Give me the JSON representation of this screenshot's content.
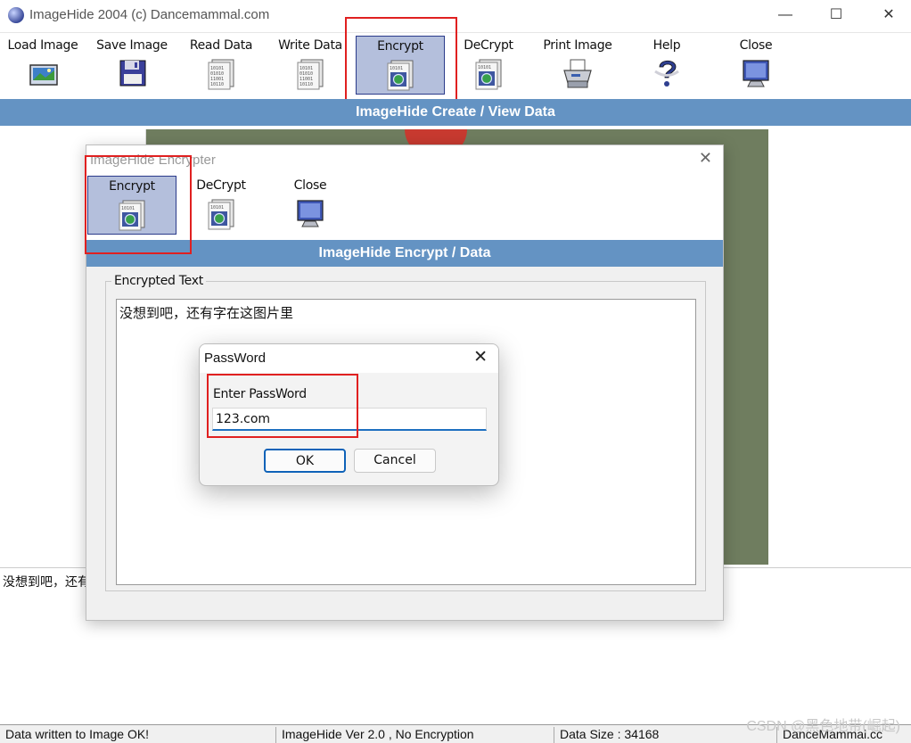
{
  "window": {
    "title": "ImageHide 2004 (c) Dancemammal.com",
    "minimize": "—",
    "maximize": "☐",
    "close": "✕"
  },
  "toolbar": {
    "items": [
      {
        "label": "Load Image",
        "icon": "load-image-icon"
      },
      {
        "label": "Save Image",
        "icon": "save-image-icon"
      },
      {
        "label": "Read Data",
        "icon": "read-data-icon"
      },
      {
        "label": "Write Data",
        "icon": "write-data-icon"
      },
      {
        "label": "Encrypt",
        "icon": "encrypt-icon"
      },
      {
        "label": "DeCrypt",
        "icon": "decrypt-icon"
      },
      {
        "label": "Print Image",
        "icon": "printer-icon"
      },
      {
        "label": "Help",
        "icon": "help-icon"
      },
      {
        "label": "Close",
        "icon": "monitor-close-icon"
      }
    ],
    "selected": "Encrypt"
  },
  "banner": {
    "text": "ImageHide Create / View Data"
  },
  "bottom_text": "没想到吧，还有",
  "statusbar": {
    "cells": [
      "Data written to Image OK!",
      "ImageHide Ver 2.0 , No Encryption",
      "Data Size : 34168",
      "DanceMammal.cc"
    ]
  },
  "watermark": "CSDN @黑色地带(崛起)",
  "encrypter": {
    "title": "ImageHide Encrypter",
    "close": "✕",
    "toolbar": [
      {
        "label": "Encrypt",
        "icon": "encrypt-icon"
      },
      {
        "label": "DeCrypt",
        "icon": "decrypt-icon"
      },
      {
        "label": "Close",
        "icon": "monitor-close-icon"
      }
    ],
    "banner": "ImageHide Encrypt / Data",
    "group_label": "Encrypted Text",
    "text": "没想到吧，还有字在这图片里"
  },
  "password_dialog": {
    "title": "PassWord",
    "close": "✕",
    "label": "Enter PassWord",
    "value": "123.com",
    "ok": "OK",
    "cancel": "Cancel"
  },
  "colors": {
    "banner": "#6493c3",
    "highlight": "#e02020",
    "selected_bg": "#b4bfdc"
  }
}
